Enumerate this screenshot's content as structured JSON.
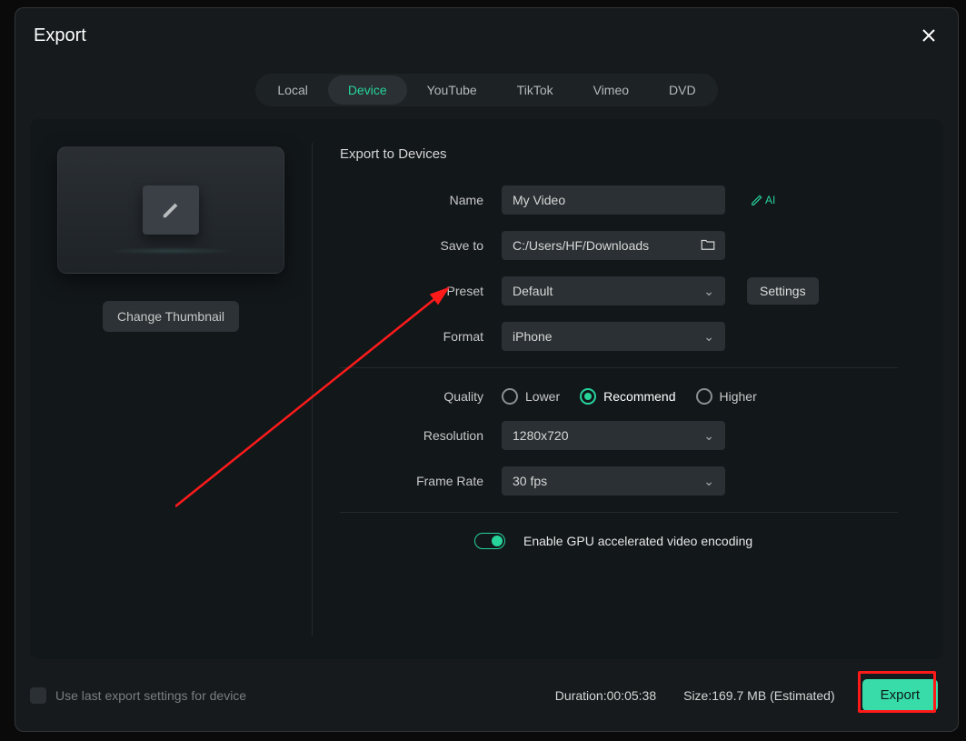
{
  "title": "Export",
  "tabs": [
    "Local",
    "Device",
    "YouTube",
    "TikTok",
    "Vimeo",
    "DVD"
  ],
  "active_tab": "Device",
  "change_thumbnail": "Change Thumbnail",
  "section_title": "Export to Devices",
  "labels": {
    "name": "Name",
    "save_to": "Save to",
    "preset": "Preset",
    "format": "Format",
    "quality": "Quality",
    "resolution": "Resolution",
    "frame_rate": "Frame Rate"
  },
  "fields": {
    "name": "My Video",
    "save_to": "C:/Users/HF/Downloads",
    "preset": "Default",
    "format": "iPhone",
    "resolution": "1280x720",
    "frame_rate": "30 fps"
  },
  "quality_options": [
    "Lower",
    "Recommend",
    "Higher"
  ],
  "quality_selected": "Recommend",
  "gpu_label": "Enable GPU accelerated video encoding",
  "settings_btn": "Settings",
  "use_last": "Use last export settings for device",
  "duration_label": "Duration:",
  "duration_value": "00:05:38",
  "size_label": "Size:",
  "size_value": "169.7 MB",
  "size_suffix": "(Estimated)",
  "export_btn": "Export",
  "ai_tag": "AI"
}
